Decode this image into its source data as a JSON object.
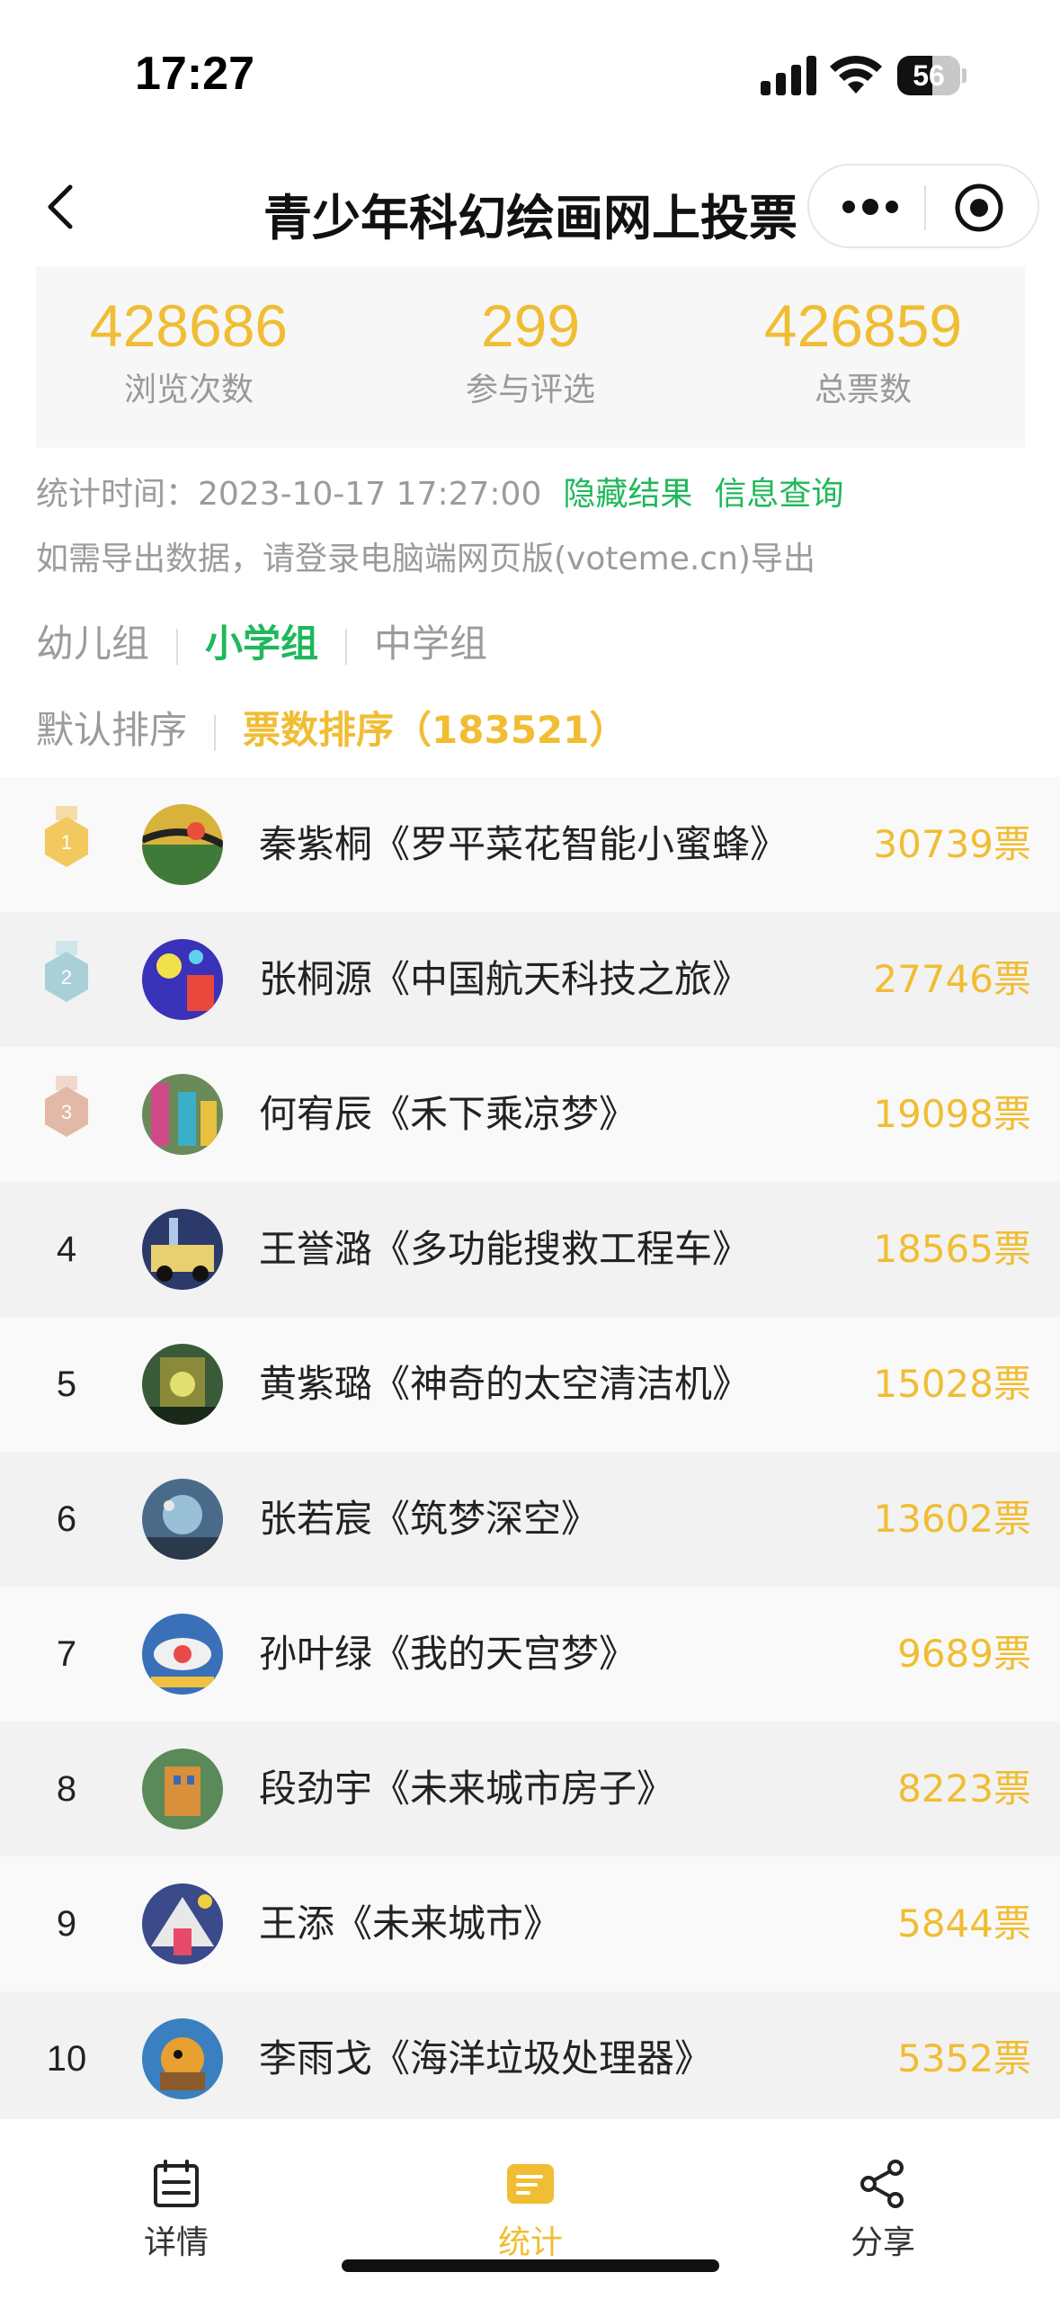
{
  "status_bar": {
    "time": "17:27",
    "battery": "56",
    "battery_level": 0.56
  },
  "nav": {
    "title": "青少年科幻绘画网上投票"
  },
  "stats": [
    {
      "value": "428686",
      "label": "浏览次数"
    },
    {
      "value": "299",
      "label": "参与评选"
    },
    {
      "value": "426859",
      "label": "总票数"
    }
  ],
  "info": {
    "stat_time": "统计时间：2023-10-17 17:27:00",
    "hide_results": "隐藏结果",
    "info_query": "信息查询",
    "export_note": "如需导出数据，请登录电脑端网页版(voteme.cn)导出"
  },
  "groups": [
    {
      "label": "幼儿组"
    },
    {
      "label": "小学组"
    },
    {
      "label": "中学组"
    }
  ],
  "sorts": {
    "default": "默认排序",
    "votes": "票数排序",
    "votes_count": "（183521）"
  },
  "entries": [
    {
      "rank": "1",
      "name": "秦紫桐《罗平菜花智能小蜜蜂》",
      "votes": "30739票"
    },
    {
      "rank": "2",
      "name": "张桐源《中国航天科技之旅》",
      "votes": "27746票"
    },
    {
      "rank": "3",
      "name": "何宥辰《禾下乘凉梦》",
      "votes": "19098票"
    },
    {
      "rank": "4",
      "name": "王誉潞《多功能搜救工程车》",
      "votes": "18565票"
    },
    {
      "rank": "5",
      "name": "黄紫璐《神奇的太空清洁机》",
      "votes": "15028票"
    },
    {
      "rank": "6",
      "name": "张若宸《筑梦深空》",
      "votes": "13602票"
    },
    {
      "rank": "7",
      "name": "孙叶绿《我的天宫梦》",
      "votes": "9689票"
    },
    {
      "rank": "8",
      "name": "段劲宇《未来城市房子》",
      "votes": "8223票"
    },
    {
      "rank": "9",
      "name": "王添《未来城市》",
      "votes": "5844票"
    },
    {
      "rank": "10",
      "name": "李雨戈《海洋垃圾处理器》",
      "votes": "5352票"
    }
  ],
  "tabs": [
    {
      "label": "详情",
      "icon": "calendar-icon"
    },
    {
      "label": "统计",
      "icon": "stats-icon"
    },
    {
      "label": "分享",
      "icon": "share-icon"
    }
  ],
  "colors": {
    "accent_yellow": "#f0bd33",
    "accent_green": "#1fb85a",
    "gold": "#f3c85e",
    "silver": "#a9d0d8",
    "bronze": "#e2b8a6"
  }
}
